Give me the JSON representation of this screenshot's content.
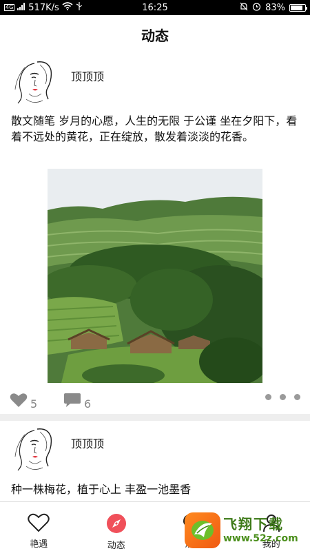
{
  "status_bar": {
    "network": "4G",
    "speed": "517K/s",
    "time": "16:25",
    "battery": "83%",
    "battery_level": 0.83
  },
  "header": {
    "title": "动态"
  },
  "posts": [
    {
      "username": "顶顶顶",
      "text": " 散文随笔 岁月的心愿，人生的无限 于公谨 坐在夕阳下，看着不远处的黄花，正在绽放，散发着淡淡的花香。",
      "likes": "5",
      "comments": "6"
    },
    {
      "username": "顶顶顶",
      "text": "种一株梅花，植于心上 丰盈一池墨香"
    }
  ],
  "bottom_nav": {
    "items": [
      {
        "label": "艳遇",
        "icon": "heart-outline-icon"
      },
      {
        "label": "动态",
        "icon": "compass-icon",
        "active": true
      },
      {
        "label": "消息",
        "icon": "chat-bubble-icon"
      },
      {
        "label": "我的",
        "icon": "profile-icon"
      }
    ]
  },
  "watermark": {
    "brand": "飞翔下载",
    "site": "www.52z.com"
  },
  "colors": {
    "accent": "#f0505a",
    "icon_grey": "#888888",
    "divider": "#eeeeee",
    "watermark_orange": "#f47a1c",
    "watermark_green": "#3d7a18"
  }
}
